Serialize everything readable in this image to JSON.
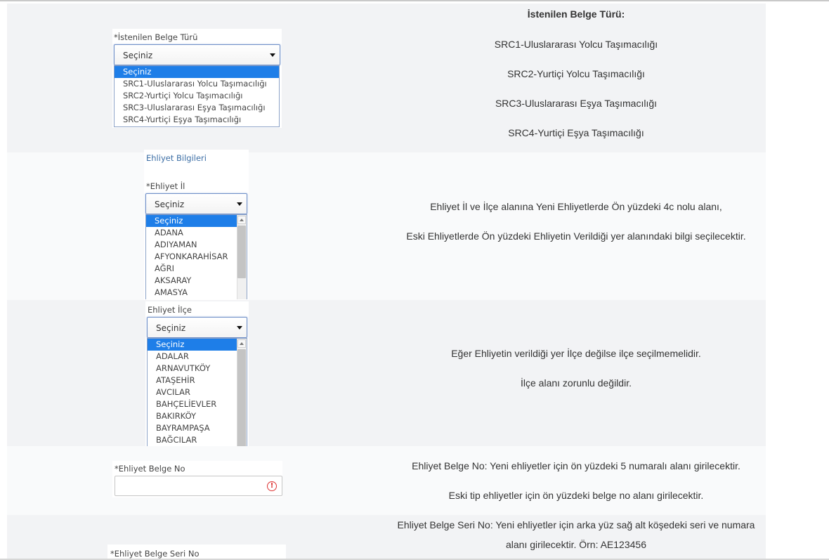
{
  "document_type": {
    "label": "*İstenilen Belge Türü",
    "selected": "Seçiniz",
    "options": [
      "Seçiniz",
      "SRC1-Uluslararası Yolcu Taşımacılığı",
      "SRC2-Yurtiçi Yolcu Taşımacılığı",
      "SRC3-Uluslararası Eşya Taşımacılığı",
      "SRC4-Yurtiçi Eşya Taşımacılığı"
    ],
    "info_title": "İstenilen Belge Türü:",
    "info_lines": [
      "SRC1-Uluslararası Yolcu Taşımacılığı",
      "SRC2-Yurtiçi Yolcu Taşımacılığı",
      "SRC3-Uluslararası Eşya Taşımacılığı",
      "SRC4-Yurtiçi Eşya Taşımacılığı"
    ]
  },
  "license_section": {
    "title": "Ehliyet Bilgileri"
  },
  "license_province": {
    "label": "*Ehliyet İl",
    "selected": "Seçiniz",
    "options": [
      "Seçiniz",
      "ADANA",
      "ADIYAMAN",
      "AFYONKARAHİSAR",
      "AĞRI",
      "AKSARAY",
      "AMASYA"
    ],
    "info_lines": [
      "Ehliyet İl ve İlçe alanına Yeni Ehliyetlerde Ön yüzdeki 4c nolu alanı,",
      "Eski Ehliyetlerde Ön yüzdeki Ehliyetin Verildiği yer alanındaki bilgi seçilecektir."
    ]
  },
  "license_district": {
    "label": "Ehliyet İlçe",
    "selected": "Seçiniz",
    "options": [
      "Seçiniz",
      "ADALAR",
      "ARNAVUTKÖY",
      "ATAŞEHİR",
      "AVCILAR",
      "BAHÇELİEVLER",
      "BAKIRKÖY",
      "BAYRAMPAŞA",
      "BAĞCILAR"
    ],
    "info_lines": [
      "Eğer Ehliyetin verildiği yer İlçe değilse ilçe seçilmemelidir.",
      "İlçe alanı zorunlu değildir."
    ]
  },
  "license_doc_no": {
    "label": "*Ehliyet Belge No",
    "value": "",
    "error_icon": "!",
    "info_lines": [
      "Ehliyet Belge No: Yeni ehliyetler için ön yüzdeki 5 numaralı alanı girilecektir.",
      "Eski tip ehliyetler için ön yüzdeki belge no alanı girilecektir."
    ]
  },
  "license_serial_no": {
    "label": "*Ehliyet Belge Seri No",
    "info_lines": [
      "Ehliyet Belge Seri No: Yeni ehliyetler için arka yüz sağ alt köşedeki seri ve numara",
      "alanı girilecektir. Örn: AE123456"
    ]
  },
  "colors": {
    "highlight": "#1e7ee8",
    "link": "#3d6fa6",
    "error": "#dd3333"
  }
}
